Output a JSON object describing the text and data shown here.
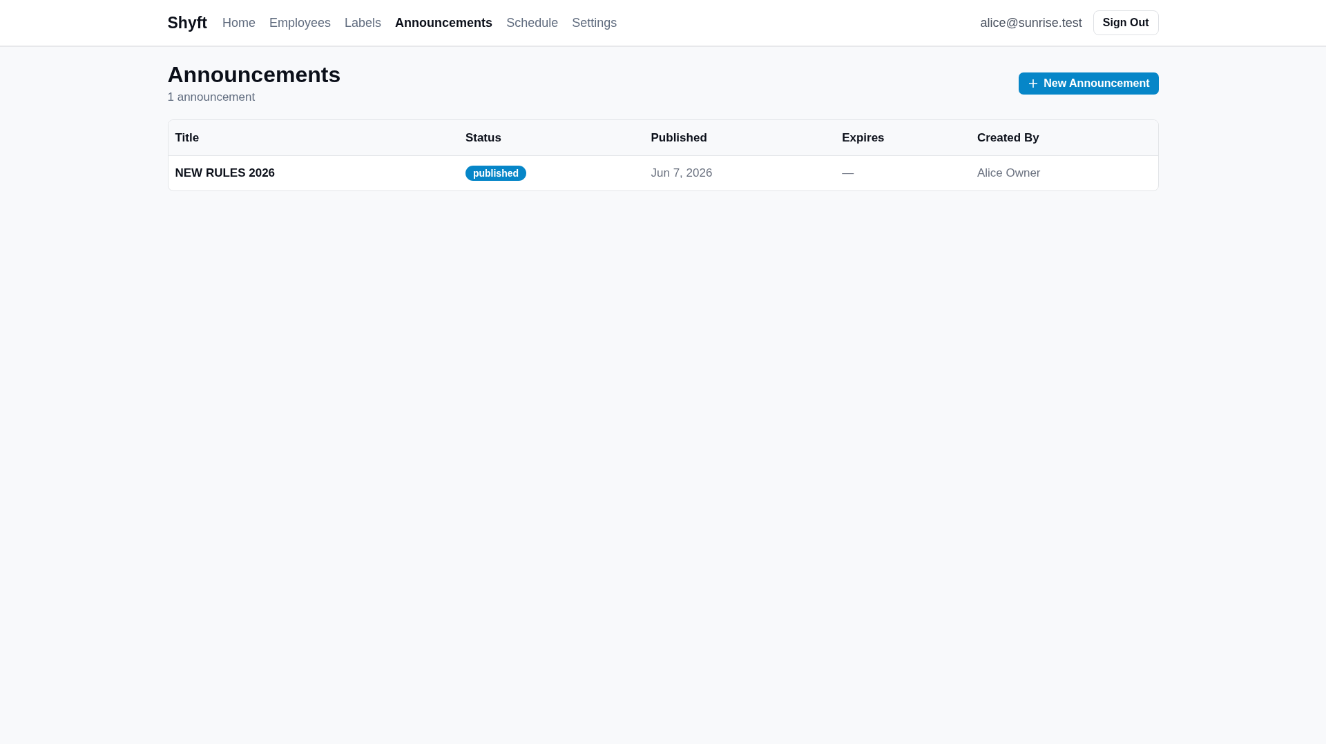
{
  "nav": {
    "brand": "Shyft",
    "links": [
      {
        "label": "Home",
        "selected": false
      },
      {
        "label": "Employees",
        "selected": false
      },
      {
        "label": "Labels",
        "selected": false
      },
      {
        "label": "Announcements",
        "selected": true
      },
      {
        "label": "Schedule",
        "selected": false
      },
      {
        "label": "Settings",
        "selected": false
      }
    ],
    "user_email": "alice@sunrise.test",
    "sign_out": "Sign Out"
  },
  "page": {
    "title": "Announcements",
    "subtitle": "1 announcement",
    "new_button": "New Announcement"
  },
  "table": {
    "columns": [
      "Title",
      "Status",
      "Published",
      "Expires",
      "Created By"
    ],
    "rows": [
      {
        "title": "NEW RULES 2026",
        "status": "published",
        "published": "Jun 7, 2026",
        "expires": "—",
        "created_by": "Alice Owner"
      }
    ]
  }
}
